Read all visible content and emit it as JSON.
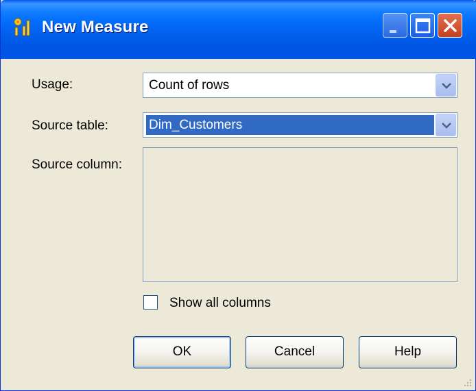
{
  "window": {
    "title": "New Measure",
    "icon": "measure-app-icon",
    "controls": [
      "minimize-icon",
      "maximize-icon",
      "close-icon"
    ]
  },
  "form": {
    "usage_label": "Usage:",
    "usage_value": "Count of rows",
    "source_table_label": "Source table:",
    "source_table_value": "Dim_Customers",
    "source_column_label": "Source column:",
    "source_column_items": [],
    "show_all_columns_label": "Show all columns",
    "show_all_columns_checked": false
  },
  "buttons": {
    "ok": "OK",
    "cancel": "Cancel",
    "help": "Help"
  },
  "colors": {
    "titlebar_blue": "#0054e3",
    "selection_blue": "#316ac5",
    "dialog_background": "#ece9d8",
    "close_red": "#d4502c"
  }
}
